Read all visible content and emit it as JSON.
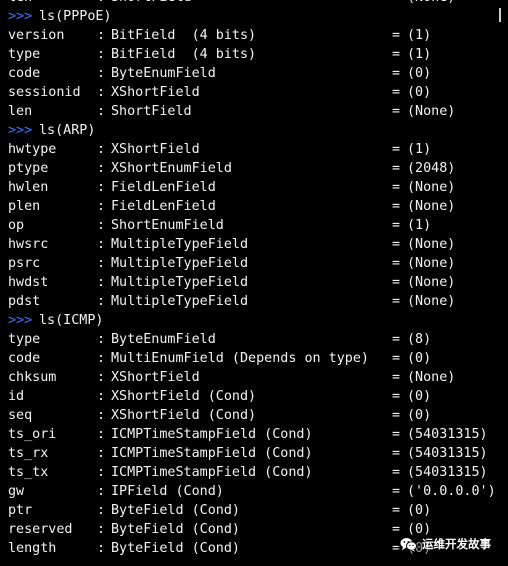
{
  "terminal": {
    "lines": [
      {
        "kind": "field",
        "name": "len",
        "type": "ShortField",
        "value": "(None)"
      },
      {
        "kind": "cmd",
        "prompt": ">>>",
        "command": "ls(PPPoE)"
      },
      {
        "kind": "field",
        "name": "version",
        "type": "BitField  (4 bits)",
        "value": "(1)"
      },
      {
        "kind": "field",
        "name": "type",
        "type": "BitField  (4 bits)",
        "value": "(1)"
      },
      {
        "kind": "field",
        "name": "code",
        "type": "ByteEnumField",
        "value": "(0)"
      },
      {
        "kind": "field",
        "name": "sessionid",
        "type": "XShortField",
        "value": "(0)"
      },
      {
        "kind": "field",
        "name": "len",
        "type": "ShortField",
        "value": "(None)"
      },
      {
        "kind": "cmd",
        "prompt": ">>>",
        "command": "ls(ARP)"
      },
      {
        "kind": "field",
        "name": "hwtype",
        "type": "XShortField",
        "value": "(1)"
      },
      {
        "kind": "field",
        "name": "ptype",
        "type": "XShortEnumField",
        "value": "(2048)"
      },
      {
        "kind": "field",
        "name": "hwlen",
        "type": "FieldLenField",
        "value": "(None)"
      },
      {
        "kind": "field",
        "name": "plen",
        "type": "FieldLenField",
        "value": "(None)"
      },
      {
        "kind": "field",
        "name": "op",
        "type": "ShortEnumField",
        "value": "(1)"
      },
      {
        "kind": "field",
        "name": "hwsrc",
        "type": "MultipleTypeField",
        "value": "(None)"
      },
      {
        "kind": "field",
        "name": "psrc",
        "type": "MultipleTypeField",
        "value": "(None)"
      },
      {
        "kind": "field",
        "name": "hwdst",
        "type": "MultipleTypeField",
        "value": "(None)"
      },
      {
        "kind": "field",
        "name": "pdst",
        "type": "MultipleTypeField",
        "value": "(None)"
      },
      {
        "kind": "cmd",
        "prompt": ">>>",
        "command": "ls(ICMP)"
      },
      {
        "kind": "field",
        "name": "type",
        "type": "ByteEnumField",
        "value": "(8)"
      },
      {
        "kind": "field",
        "name": "code",
        "type": "MultiEnumField (Depends on type)",
        "value": "(0)"
      },
      {
        "kind": "field",
        "name": "chksum",
        "type": "XShortField",
        "value": "(None)"
      },
      {
        "kind": "field",
        "name": "id",
        "type": "XShortField (Cond)",
        "value": "(0)"
      },
      {
        "kind": "field",
        "name": "seq",
        "type": "XShortField (Cond)",
        "value": "(0)"
      },
      {
        "kind": "field",
        "name": "ts_ori",
        "type": "ICMPTimeStampField (Cond)",
        "value": "(54031315)"
      },
      {
        "kind": "field",
        "name": "ts_rx",
        "type": "ICMPTimeStampField (Cond)",
        "value": "(54031315)"
      },
      {
        "kind": "field",
        "name": "ts_tx",
        "type": "ICMPTimeStampField (Cond)",
        "value": "(54031315)"
      },
      {
        "kind": "field",
        "name": "gw",
        "type": "IPField (Cond)",
        "value": "('0.0.0.0')"
      },
      {
        "kind": "field",
        "name": "ptr",
        "type": "ByteField (Cond)",
        "value": "(0)"
      },
      {
        "kind": "field",
        "name": "reserved",
        "type": "ByteField (Cond)",
        "value": "(0)"
      },
      {
        "kind": "field",
        "name": "length",
        "type": "ByteField (Cond)",
        "value": "(0)"
      }
    ],
    "colon": ":",
    "equals": "="
  },
  "colors": {
    "background": "#000000",
    "text": "#f2f2f2",
    "prompt": "#3b78ff"
  },
  "watermark": {
    "icon": "wechat-icon",
    "text": "运维开发故事"
  }
}
